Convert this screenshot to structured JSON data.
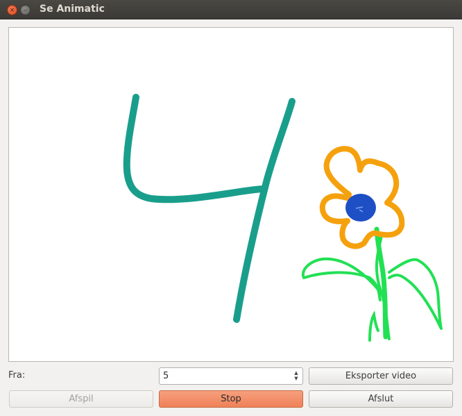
{
  "window": {
    "title": "Se Animatic",
    "close_glyph": "×",
    "min_glyph": "–"
  },
  "controls": {
    "from_label": "Fra:",
    "frame_value": "5",
    "export_label": "Eksporter video",
    "play_label": "Afspil",
    "stop_label": "Stop",
    "quit_label": "Afslut"
  },
  "canvas": {
    "frame_number_drawn": "4",
    "drawing_colors": {
      "digit": "#1a9e8c",
      "petals": "#f5a10e",
      "center": "#1e4fc4",
      "stem": "#22e054"
    }
  },
  "icons": {
    "close": "close-icon",
    "minimize": "minimize-icon",
    "spin_up": "chevron-up-icon",
    "spin_down": "chevron-down-icon"
  },
  "accent": {
    "active_button": "#ef8158"
  }
}
